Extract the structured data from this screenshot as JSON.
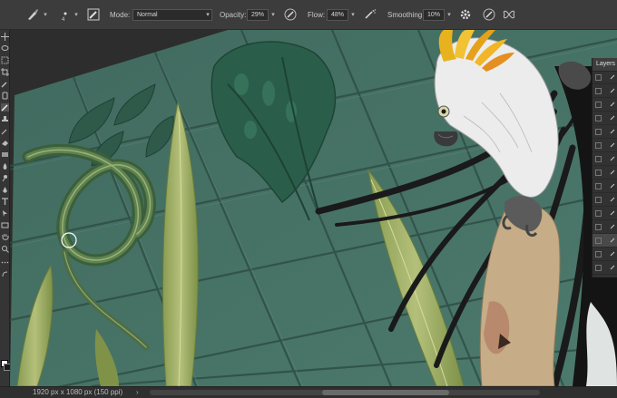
{
  "options_bar": {
    "brush_size": "4",
    "mode_label": "Mode:",
    "mode_value": "Normal",
    "opacity_label": "Opacity:",
    "opacity_value": "29%",
    "flow_label": "Flow:",
    "flow_value": "48%",
    "smoothing_label": "Smoothing:",
    "smoothing_value": "10%"
  },
  "layers_panel": {
    "title": "Layers"
  },
  "status_bar": {
    "doc_info": "1920 px x 1080 px (150 ppi)",
    "arrow": "›"
  },
  "colors": {
    "ui_dark": "#2b2b2b",
    "options_bar": "#3c3c3c",
    "tile_green": "#466e62",
    "grout": "#2f4e45"
  }
}
